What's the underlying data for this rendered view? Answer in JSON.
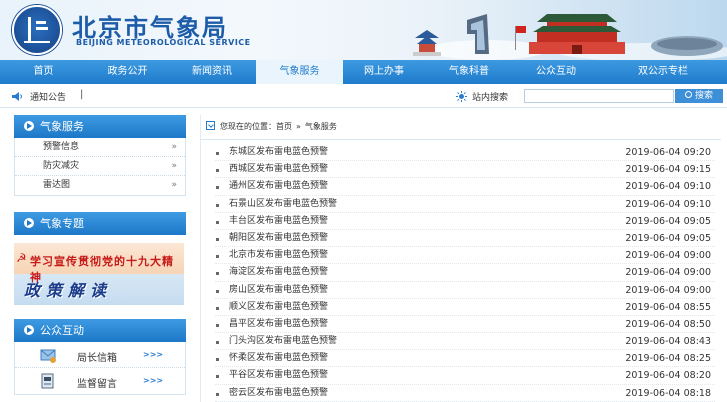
{
  "header": {
    "title": "北京市气象局",
    "subtitle": "BEIJING METEOROLOGICAL SERVICE"
  },
  "nav": {
    "items": [
      {
        "label": "首页",
        "active": false
      },
      {
        "label": "政务公开",
        "active": false
      },
      {
        "label": "新闻资讯",
        "active": false
      },
      {
        "label": "气象服务",
        "active": true
      },
      {
        "label": "网上办事",
        "active": false
      },
      {
        "label": "气象科普",
        "active": false
      },
      {
        "label": "公众互动",
        "active": false
      },
      {
        "label": "双公示专栏",
        "active": false
      }
    ]
  },
  "notice": {
    "label": "通知公告",
    "separator": "|"
  },
  "search": {
    "label": "站内搜索",
    "placeholder": "",
    "button": "搜索"
  },
  "sidebar": {
    "weather_service": {
      "title": "气象服务",
      "items": [
        {
          "label": "预警信息",
          "chevron": "»"
        },
        {
          "label": "防灾减灾",
          "chevron": "»"
        },
        {
          "label": "雷达图",
          "chevron": "»"
        }
      ]
    },
    "weather_topic": {
      "title": "气象专题",
      "banner_line1": "学习宣传贯彻党的十九大精神",
      "banner_line2": "政策解读"
    },
    "public_interaction": {
      "title": "公众互动",
      "items": [
        {
          "label": "局长信箱",
          "arrow": ">>>"
        },
        {
          "label": "监督留言",
          "arrow": ">>>"
        }
      ]
    }
  },
  "breadcrumb": {
    "prefix": "您现在的位置：",
    "home": "首页",
    "sep": "»",
    "current": "气象服务"
  },
  "news": [
    {
      "title": "东城区发布雷电蓝色预警",
      "date": "2019-06-04 09:20"
    },
    {
      "title": "西城区发布雷电蓝色预警",
      "date": "2019-06-04 09:15"
    },
    {
      "title": "通州区发布雷电蓝色预警",
      "date": "2019-06-04 09:10"
    },
    {
      "title": "石景山区发布雷电蓝色预警",
      "date": "2019-06-04 09:10"
    },
    {
      "title": "丰台区发布雷电蓝色预警",
      "date": "2019-06-04 09:05"
    },
    {
      "title": "朝阳区发布雷电蓝色预警",
      "date": "2019-06-04 09:05"
    },
    {
      "title": "北京市发布雷电蓝色预警",
      "date": "2019-06-04 09:00"
    },
    {
      "title": "海淀区发布雷电蓝色预警",
      "date": "2019-06-04 09:00"
    },
    {
      "title": "房山区发布雷电蓝色预警",
      "date": "2019-06-04 09:00"
    },
    {
      "title": "顺义区发布雷电蓝色预警",
      "date": "2019-06-04 08:55"
    },
    {
      "title": "昌平区发布雷电蓝色预警",
      "date": "2019-06-04 08:50"
    },
    {
      "title": "门头沟区发布雷电蓝色预警",
      "date": "2019-06-04 08:43"
    },
    {
      "title": "怀柔区发布雷电蓝色预警",
      "date": "2019-06-04 08:25"
    },
    {
      "title": "平谷区发布雷电蓝色预警",
      "date": "2019-06-04 08:20"
    },
    {
      "title": "密云区发布雷电蓝色预警",
      "date": "2019-06-04 08:18"
    }
  ],
  "colors": {
    "brand_blue": "#1f7bcc",
    "nav_active_bg": "#eaf4fc",
    "title_blue": "#1d5ca8"
  },
  "icons": [
    "logo-emblem",
    "skyline-illustration",
    "speaker-icon",
    "search-sun-icon",
    "magnifier-icon",
    "mailbox-icon",
    "message-icon",
    "breadcrumb-icon"
  ]
}
